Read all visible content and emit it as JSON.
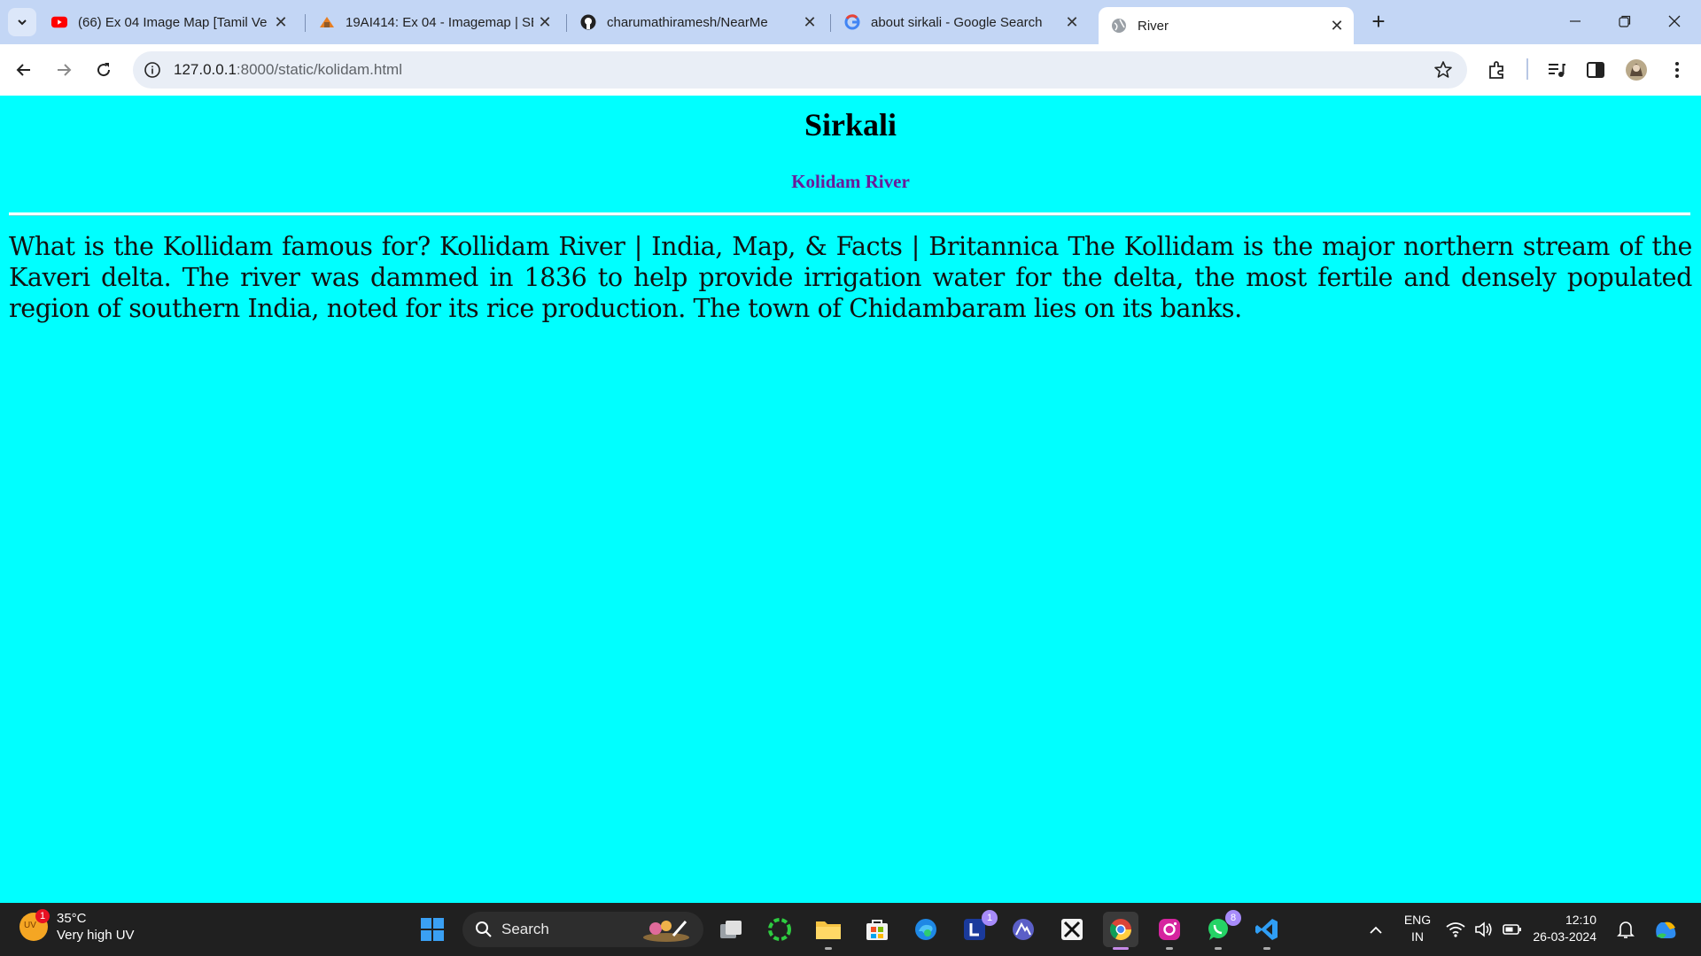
{
  "browser": {
    "tabs": [
      {
        "title": "(66) Ex 04 Image Map [Tamil Ve",
        "icon": "youtube-icon",
        "active": false
      },
      {
        "title": "19AI414: Ex 04 - Imagemap | SE",
        "icon": "course-site-icon",
        "active": false
      },
      {
        "title": "charumathiramesh/NearMe",
        "icon": "github-icon",
        "active": false
      },
      {
        "title": "about sirkali - Google Search",
        "icon": "google-icon",
        "active": false
      },
      {
        "title": "River",
        "icon": "globe-icon",
        "active": true
      }
    ],
    "new_tab_label": "+",
    "url_host": "127.0.0.1",
    "url_path": ":8000/static/kolidam.html"
  },
  "page": {
    "heading": "Sirkali",
    "subheading": "Kolidam River",
    "paragraph": "What is the Kollidam famous for? Kollidam River | India, Map, & Facts | Britannica The Kollidam is the major northern stream of the Kaveri delta. The river was dammed in 1836 to help provide irrigation water for the delta, the most fertile and densely populated region of southern India, noted for its rice production. The town of Chidambaram lies on its banks.",
    "background_color": "#00ffff",
    "subheading_color": "#6a1b9a"
  },
  "taskbar": {
    "weather": {
      "temp": "35°C",
      "condition": "Very high UV",
      "badge": "1",
      "uv_label": "UV"
    },
    "search_label": "Search",
    "notif_l": "1",
    "notif_whatsapp": "8",
    "lang_top": "ENG",
    "lang_bottom": "IN",
    "time": "12:10",
    "date": "26-03-2024"
  }
}
